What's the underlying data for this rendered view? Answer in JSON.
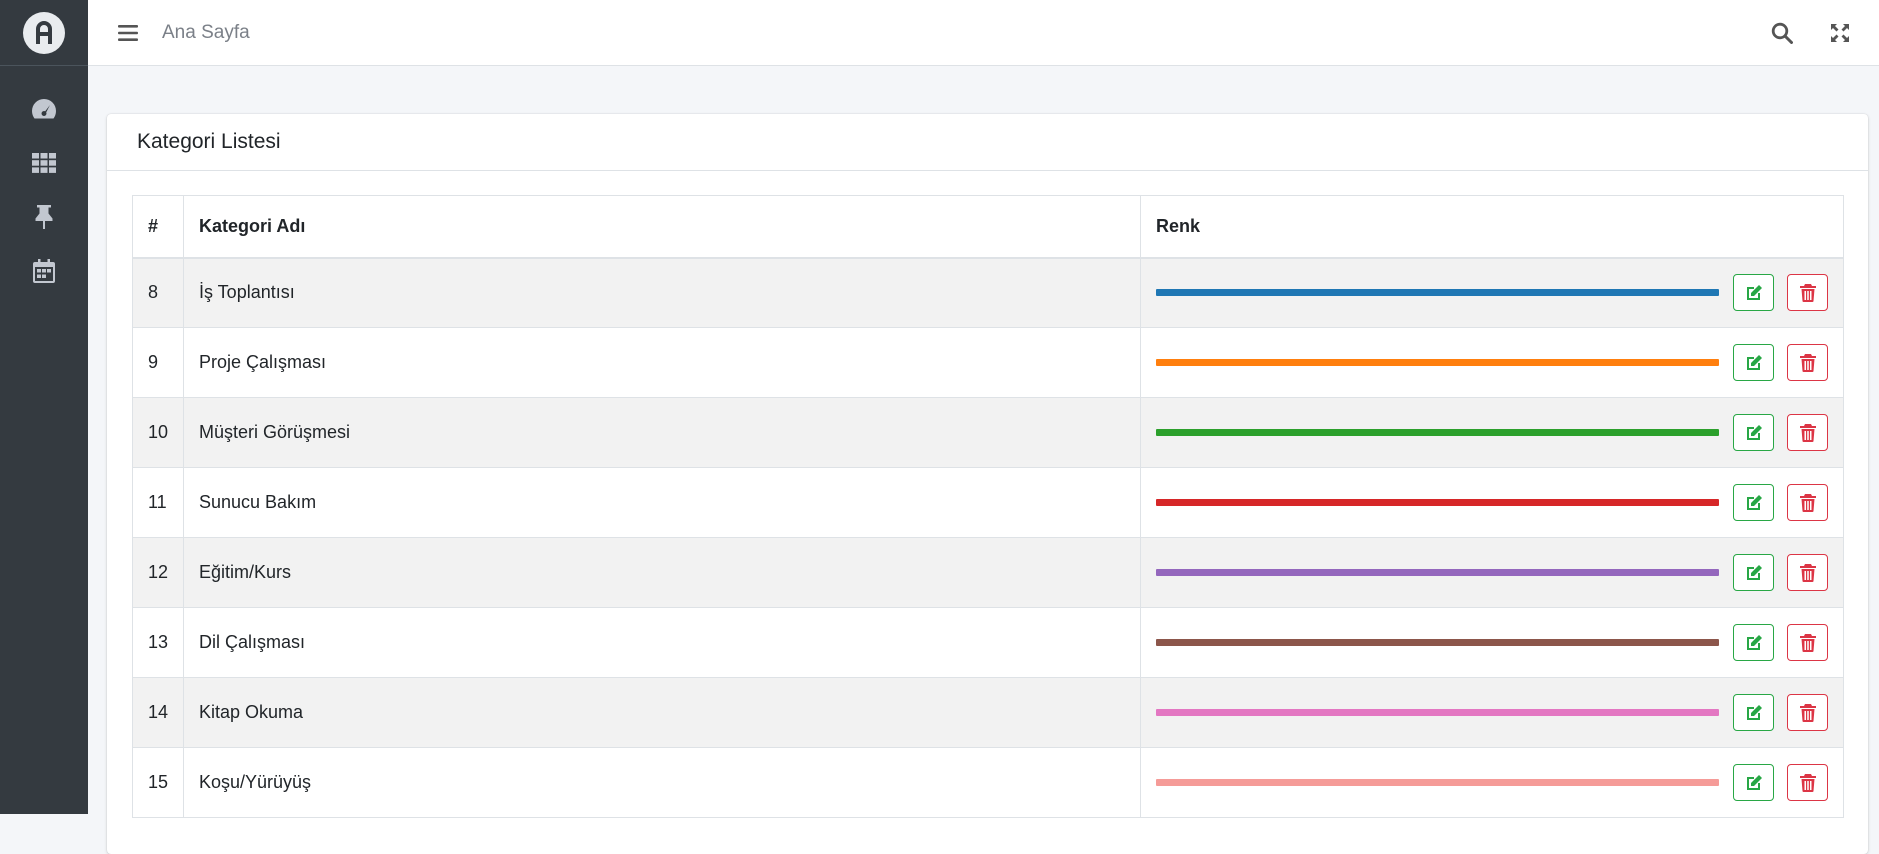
{
  "topbar": {
    "home_label": "Ana Sayfa"
  },
  "sidebar": {
    "items": [
      {
        "name": "dashboard",
        "icon": "tachometer-icon"
      },
      {
        "name": "grid",
        "icon": "grid-icon"
      },
      {
        "name": "pin",
        "icon": "thumbtack-icon"
      },
      {
        "name": "calendar",
        "icon": "calendar-icon"
      }
    ]
  },
  "card": {
    "title": "Kategori Listesi"
  },
  "table": {
    "headers": {
      "num": "#",
      "name": "Kategori Adı",
      "color": "Renk"
    },
    "rows": [
      {
        "id": "8",
        "name": "İş Toplantısı",
        "color": "#1f77b4"
      },
      {
        "id": "9",
        "name": "Proje Çalışması",
        "color": "#ff7f0e"
      },
      {
        "id": "10",
        "name": "Müşteri Görüşmesi",
        "color": "#2ca02c"
      },
      {
        "id": "11",
        "name": "Sunucu Bakım",
        "color": "#d62728"
      },
      {
        "id": "12",
        "name": "Eğitim/Kurs",
        "color": "#9467bd"
      },
      {
        "id": "13",
        "name": "Dil Çalışması",
        "color": "#8c564b"
      },
      {
        "id": "14",
        "name": "Kitap Okuma",
        "color": "#e377c2"
      },
      {
        "id": "15",
        "name": "Koşu/Yürüyüş",
        "color": "#f59b98"
      }
    ]
  },
  "colors": {
    "sidebar_bg": "#343a40",
    "edit": "#28a745",
    "delete": "#dc3545"
  }
}
